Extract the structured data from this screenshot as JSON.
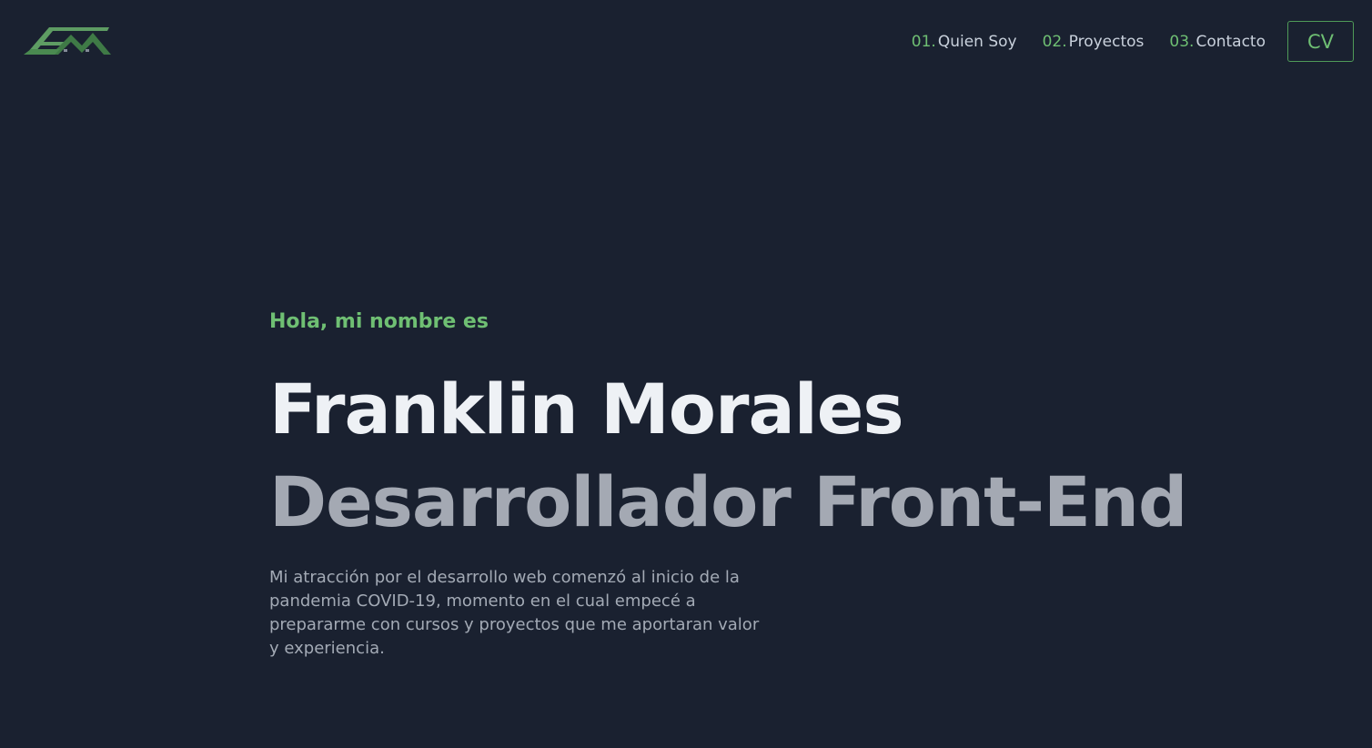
{
  "header": {
    "logo_text": "FM",
    "nav": [
      {
        "number": "01.",
        "label": "Quien Soy"
      },
      {
        "number": "02.",
        "label": "Proyectos"
      },
      {
        "number": "03.",
        "label": "Contacto"
      }
    ],
    "cv_label": "CV"
  },
  "hero": {
    "greeting": "Hola, mi nombre es",
    "name": "Franklin Morales",
    "role": "Desarrollador Front-End",
    "bio": "Mi atracción por el desarrollo web comenzó al inicio de la pandemia COVID-19, momento en el cual empecé a prepararme con cursos y proyectos que me aportaran valor y experiencia."
  },
  "colors": {
    "background": "#1a2130",
    "accent": "#6fbf73",
    "heading": "#eef1f5",
    "subheading": "#a4a9b3",
    "body_text": "#a3aab5"
  }
}
